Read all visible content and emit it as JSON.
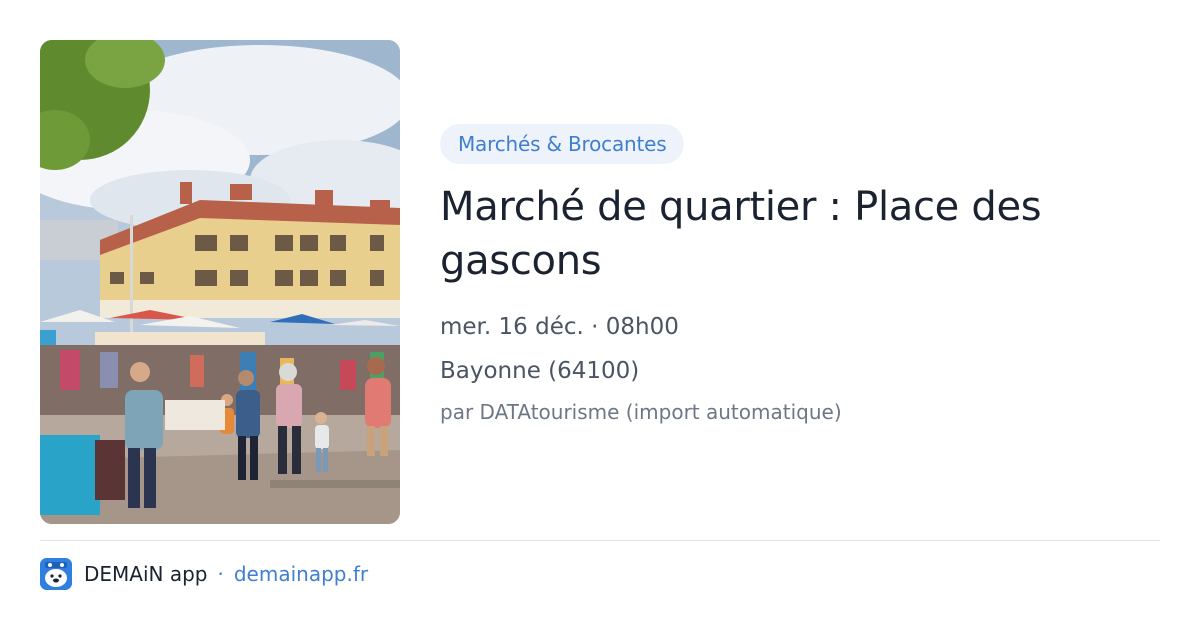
{
  "event": {
    "category": "Marchés & Brocantes",
    "title": "Marché de quartier : Place des gascons",
    "date": "mer. 16 déc. · 08h00",
    "location": "Bayonne (64100)",
    "author": "par DATAtourisme (import automatique)"
  },
  "footer": {
    "app_name": "DEMAiN app",
    "separator": "·",
    "domain": "demainapp.fr",
    "icon": "calendar-bear-icon"
  },
  "colors": {
    "accent": "#3f7fcf",
    "chip_background": "#eef3fb",
    "title": "#1b2230",
    "muted": "#4b5462",
    "app_icon": "#2f7fe0"
  }
}
